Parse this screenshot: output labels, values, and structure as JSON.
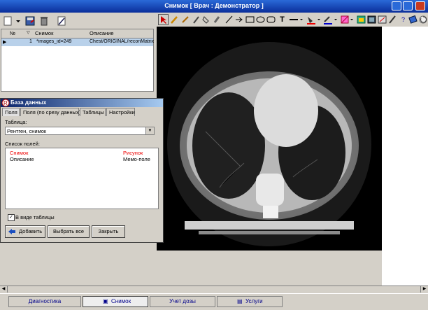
{
  "window": {
    "title": "Снимок  [ Врач : Демонстратор  ]",
    "colors": {
      "title_bar": "#1a4ec0",
      "image_bg": "#000000",
      "selected_row": "#b9d1ea",
      "link_text": "#00008b"
    }
  },
  "grid": {
    "columns": [
      "№",
      "Снимок",
      "Описание"
    ],
    "rows": [
      {
        "num": "1",
        "image": "*images_id=249",
        "desc": "Chest/ORIGINAL/reconMatrix"
      }
    ]
  },
  "dialog": {
    "title": "База данных",
    "tabs": [
      "Поля",
      "Поля (по срезу данных)",
      "Таблицы",
      "Настройки"
    ],
    "table_label": "Таблица:",
    "table_value": "Рентген, снимок",
    "fields_label": "Список полей:",
    "fields": [
      {
        "name": "Снимок",
        "type": "Рисунок",
        "highlight": true
      },
      {
        "name": "Описание",
        "type": "Мемо-поле",
        "highlight": false
      }
    ],
    "as_table_label": "В виде таблицы",
    "as_table_checked": true,
    "buttons": {
      "add": "Добавить",
      "select_all": "Выбрать все",
      "close": "Закрыть"
    }
  },
  "taskbar": {
    "items": [
      {
        "label": "Диагностика",
        "active": false
      },
      {
        "label": "Снимок",
        "active": true
      },
      {
        "label": "Учет дозы",
        "active": false
      },
      {
        "label": "Услуги",
        "active": false
      }
    ]
  },
  "icons": [
    "new-doc-icon",
    "dropdown-arrow-icon",
    "save-icon",
    "trash-icon",
    "edit-icon",
    "pointer-icon",
    "pencil-icon",
    "brush-icon",
    "marker-icon",
    "fill-icon",
    "eraser-icon",
    "line-icon",
    "arrow-icon",
    "rectangle-icon",
    "ellipse-icon",
    "rounded-rect-icon",
    "text-icon",
    "line-style-icon",
    "color-fill-icon",
    "line-color-icon",
    "ruler-icon",
    "histogram-icon",
    "invert-icon",
    "measure-icon",
    "lens-icon",
    "help-icon",
    "refresh-icon",
    "database-icon"
  ]
}
